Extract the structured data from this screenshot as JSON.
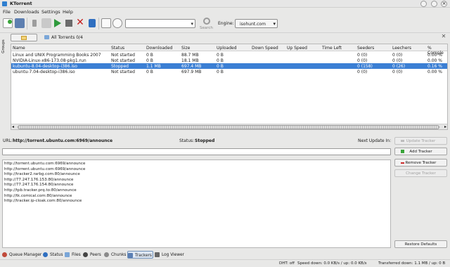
{
  "window": {
    "title": "KTorrent"
  },
  "menu": [
    "File",
    "Downloads",
    "Settings",
    "Help"
  ],
  "toolbar": {
    "search_label": "Search",
    "engine_label": "Engine:",
    "engine_value": "isohunt.com",
    "icons": [
      "new-torrent-icon",
      "open-torrent-icon",
      "remove-torrent-icon",
      "queue-icon",
      "start-icon",
      "stop-icon",
      "delete-icon",
      "torrent-app-icon",
      "queue-manager-icon",
      "speed-limit-icon",
      "pause-icon",
      "search-icon"
    ]
  },
  "groups_tab": "Groups",
  "view_tab": {
    "label": "All Torrents 0/4"
  },
  "table": {
    "columns": [
      "Name",
      "Status",
      "Downloaded",
      "Size",
      "Uploaded",
      "Down Speed",
      "Up Speed",
      "Time Left",
      "Seeders",
      "Leechers",
      "% Comple"
    ],
    "rows": [
      [
        "Linux and UNIX Programming Books 2007",
        "Not started",
        "0 B",
        "88.7 MB",
        "0 B",
        "",
        "",
        "",
        "0 (0)",
        "0 (0)",
        "0.00 %"
      ],
      [
        "NVIDIA-Linux-x86-173.08-pkg1.run",
        "Not started",
        "0 B",
        "18.1 MB",
        "0 B",
        "",
        "",
        "",
        "0 (0)",
        "0 (0)",
        "0.00 %"
      ],
      [
        "kubuntu-8.04-desktop-i386.iso",
        "Stopped",
        "1.1 MB",
        "697.4 MB",
        "0 B",
        "",
        "",
        "",
        "0 (158)",
        "0 (26)",
        "0.16 %"
      ],
      [
        "ubuntu-7.04-desktop-i386.iso",
        "Not started",
        "0 B",
        "697.9 MB",
        "0 B",
        "",
        "",
        "",
        "0 (0)",
        "0 (0)",
        "0.00 %"
      ]
    ],
    "selected_row": 2
  },
  "info": {
    "url_label": "URL:",
    "url_value": "http://torrent.ubuntu.com:6969/announce",
    "status_label": "Status:",
    "status_value": "Stopped",
    "next_update_label": "Next Update In:"
  },
  "trackers": {
    "input_value": "",
    "list": [
      "http://torrent.ubuntu.com:6969/announce",
      "http://torrent.ubuntu.com:6969/announce",
      "http://tracker2.rarbg.com:80/announce",
      "http://77.247.176.153:80/announce",
      "http://77.247.176.154:80/announce",
      "http://tpb.tracker.prq.to:80/announce",
      "http://tk.comical.com:80/announce",
      "http://tracker.ip-cloak.com:80/announce"
    ],
    "buttons": {
      "update": "Update Tracker",
      "add": "Add Tracker",
      "remove": "Remove Tracker",
      "change": "Change Tracker",
      "restore": "Restore Defaults"
    }
  },
  "bottom_tabs": [
    "Queue Manager",
    "Status",
    "Files",
    "Peers",
    "Chunks",
    "Trackers",
    "Log Viewer"
  ],
  "active_bottom_tab": "Trackers",
  "statusbar": {
    "dht": "DHT: off",
    "speed": "Speed down: 0.0 KB/s / up: 0.0 KB/s",
    "transferred": "Transferred down: 1.1 MB / up: 0 B"
  },
  "colors": {
    "selection": "#3b7fd4",
    "add_green": "#3aa53a",
    "remove_red": "#cc2b2b"
  }
}
